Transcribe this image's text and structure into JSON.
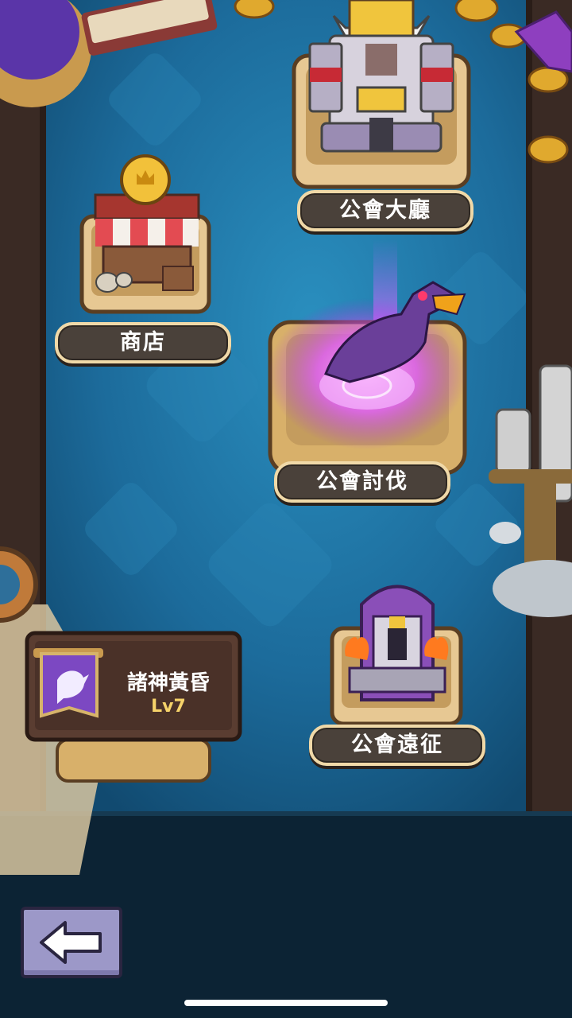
{
  "buildings": [
    {
      "id": "guild-hall",
      "label": "公會大廳"
    },
    {
      "id": "shop",
      "label": "商店"
    },
    {
      "id": "guild-raid",
      "label": "公會討伐"
    },
    {
      "id": "guild-expedition",
      "label": "公會遠征"
    }
  ],
  "guild": {
    "name": "諸神黃昏",
    "level": "Lv7"
  },
  "back_button": {
    "icon": "left-arrow-icon"
  },
  "colors": {
    "background": "#1e6f9e",
    "label_bg": "#4a413a",
    "label_border": "#f0d9a8",
    "raid_glow": "#e25cff",
    "back_button": "#9c98c8"
  }
}
